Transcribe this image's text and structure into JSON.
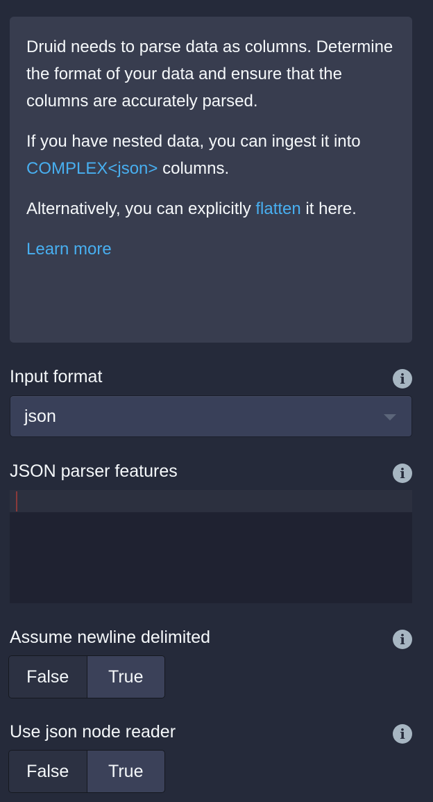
{
  "callout": {
    "para1": "Druid needs to parse data as columns. Determine the format of your data and ensure that the columns are accurately parsed.",
    "para2_before": "If you have nested data, you can ingest it into ",
    "para2_link": "COMPLEX<json>",
    "para2_after": " columns.",
    "para3_before": "Alternatively, you can explicitly ",
    "para3_link": "flatten",
    "para3_after": " it here.",
    "learn_more": "Learn more"
  },
  "fields": {
    "input_format": {
      "label": "Input format",
      "value": "json"
    },
    "json_parser_features": {
      "label": "JSON parser features",
      "value": ""
    },
    "assume_newline_delimited": {
      "label": "Assume newline delimited",
      "options": [
        "False",
        "True"
      ],
      "selected": "True"
    },
    "use_json_node_reader": {
      "label": "Use json node reader",
      "options": [
        "False",
        "True"
      ],
      "selected": "True"
    }
  },
  "colors": {
    "background": "#252a3a",
    "callout_bg": "#383d4f",
    "link": "#48aff0",
    "text": "#f5f8fa"
  },
  "icons": [
    "info-icon",
    "caret-down-icon"
  ]
}
